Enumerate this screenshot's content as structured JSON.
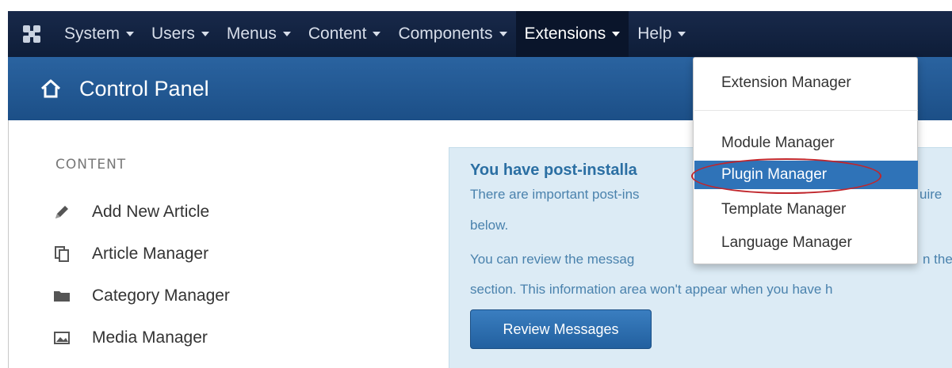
{
  "nav": {
    "items": [
      {
        "label": "System"
      },
      {
        "label": "Users"
      },
      {
        "label": "Menus"
      },
      {
        "label": "Content"
      },
      {
        "label": "Components"
      },
      {
        "label": "Extensions"
      },
      {
        "label": "Help"
      }
    ],
    "logo_icon": "joomla-logo-icon",
    "active_item": "Extensions"
  },
  "header": {
    "title": "Control Panel",
    "icon": "home-icon"
  },
  "sidebar": {
    "section_title": "CONTENT",
    "items": [
      {
        "label": "Add New Article",
        "icon": "pencil-icon"
      },
      {
        "label": "Article Manager",
        "icon": "copy-icon"
      },
      {
        "label": "Category Manager",
        "icon": "folder-icon"
      },
      {
        "label": "Media Manager",
        "icon": "image-icon"
      }
    ]
  },
  "message_panel": {
    "title": "You have post-installa",
    "line1": "There are important post-ins",
    "line1_right": "uire",
    "line2": "below.",
    "line3": "You can review the messag",
    "line3_right": "n the",
    "line4": "section. This information area won't appear when you have h",
    "button_label": "Review Messages"
  },
  "extensions_menu": {
    "items": [
      {
        "label": "Extension Manager"
      },
      {
        "label": "Module Manager"
      },
      {
        "label": "Plugin Manager"
      },
      {
        "label": "Template Manager"
      },
      {
        "label": "Language Manager"
      }
    ],
    "highlighted": "Plugin Manager"
  },
  "colors": {
    "topbar": "#18294a",
    "header": "#2a63a0",
    "panel_bg": "#dcebf5",
    "highlight": "#2f73b8",
    "annotation": "#c0262c"
  }
}
